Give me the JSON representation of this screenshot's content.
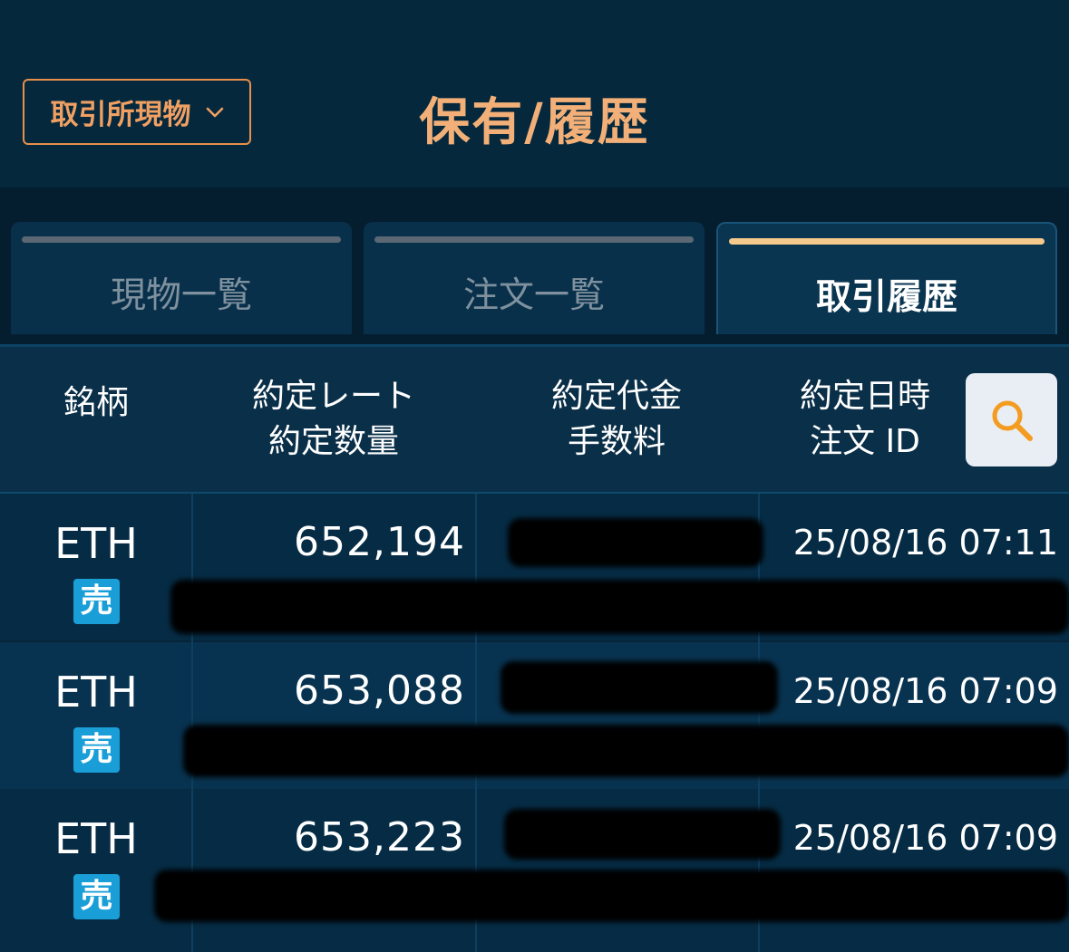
{
  "header": {
    "market_selector": "取引所現物",
    "title": "保有/履歴"
  },
  "tabs": [
    {
      "label": "現物一覧",
      "active": false
    },
    {
      "label": "注文一覧",
      "active": false
    },
    {
      "label": "取引履歴",
      "active": true
    }
  ],
  "columns": {
    "symbol": "銘柄",
    "rate": "約定レート",
    "quantity": "約定数量",
    "amount": "約定代金",
    "fee": "手数料",
    "datetime": "約定日時",
    "order_id": "注文 ID"
  },
  "rows": [
    {
      "symbol": "ETH",
      "side": "売",
      "rate": "652,194",
      "datetime": "25/08/16 07:11"
    },
    {
      "symbol": "ETH",
      "side": "売",
      "rate": "653,088",
      "datetime": "25/08/16 07:09"
    },
    {
      "symbol": "ETH",
      "side": "売",
      "rate": "653,223",
      "datetime": "25/08/16 07:09"
    }
  ],
  "colors": {
    "accent": "#e8904a",
    "title": "#f2b078",
    "active_tab_bar": "#f5c98b",
    "sell_badge": "#1a9ed8",
    "search_icon": "#f39c1f"
  },
  "icons": {
    "market_selector": "chevron-down-icon",
    "search": "search-icon"
  }
}
